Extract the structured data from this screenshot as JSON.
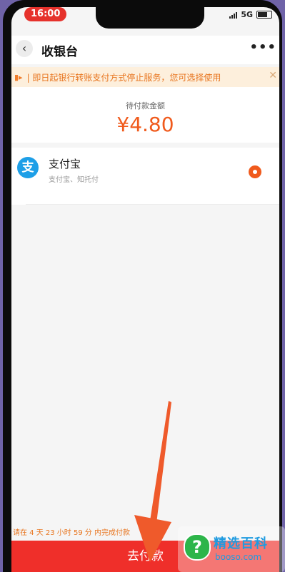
{
  "status_bar": {
    "time": "16:00",
    "network": "5G"
  },
  "header": {
    "back_icon": "‹",
    "title": "收银台",
    "more_icon": "•••"
  },
  "notice": {
    "text": "| 即日起银行转账支付方式停止服务，您可选择使用",
    "close_icon": "✕"
  },
  "amount": {
    "label": "待付款金额",
    "value": "¥4.80"
  },
  "payment_method": {
    "name": "支付宝",
    "sub": "支付宝、知托付",
    "icon_glyph": "支",
    "selected": true
  },
  "countdown": "请在 4 天 23 小时 59 分 内完成付款",
  "pay_button": "去付款",
  "watermark": {
    "title": "精选百科",
    "url": "booso.com",
    "icon_glyph": "?"
  },
  "colors": {
    "accent": "#f05a1c",
    "pay_bar": "#ef2f2a",
    "notice_bg": "#fdefdc",
    "alipay": "#1e9fe7"
  }
}
